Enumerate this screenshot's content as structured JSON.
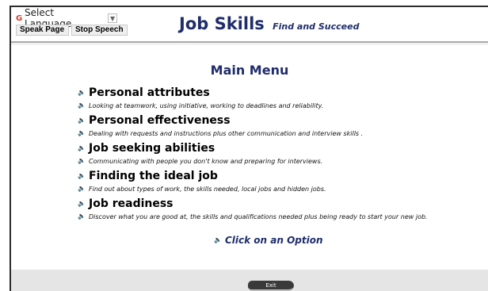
{
  "header": {
    "language_select": "Select Language",
    "language_icon": "G",
    "speak_page": "Speak Page",
    "stop_speech": "Stop Speech",
    "site_title": "Job Skills",
    "tagline": "Find and Succeed"
  },
  "main": {
    "title": "Main Menu",
    "items": [
      {
        "title": "Personal attributes",
        "description": "Looking at teamwork, using initiative, working to deadlines and reliability."
      },
      {
        "title": "Personal effectiveness",
        "description": "Dealing with requests and instructions plus other communication and interview skills ."
      },
      {
        "title": "Job seeking abilities",
        "description": "Communicating with people you don't know and preparing for interviews."
      },
      {
        "title": "Finding the ideal job",
        "description": "Find out about types of work, the skills needed, local jobs and hidden jobs."
      },
      {
        "title": "Job readiness",
        "description": "Discover what you are good at, the skills and qualifications needed plus being ready to start your new job."
      }
    ],
    "prompt": "Click on an Option"
  },
  "footer": {
    "exit": "Exit"
  },
  "icons": {
    "speaker": "speaker-icon",
    "google": "google-g-icon",
    "dropdown": "chevron-down-icon"
  },
  "colors": {
    "title_navy": "#1f2d6b",
    "footer_gray": "#e5e5e5",
    "speaker_gold": "#c8b04a"
  }
}
